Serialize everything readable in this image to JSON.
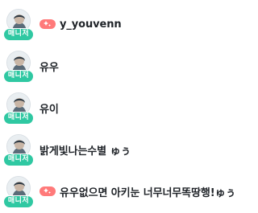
{
  "users": [
    {
      "name": "y_youvenn",
      "role_badge": "매니저",
      "has_pink_badge": true,
      "avatar_icon": "avatar-image"
    },
    {
      "name": "유우",
      "role_badge": "매니저",
      "has_pink_badge": false,
      "avatar_icon": "avatar-image"
    },
    {
      "name": "유이",
      "role_badge": "매니저",
      "has_pink_badge": false,
      "avatar_icon": "avatar-image"
    },
    {
      "name": "밝게빛나는수별 ゅぅ",
      "role_badge": "매니저",
      "has_pink_badge": false,
      "avatar_icon": "avatar-image"
    },
    {
      "name": "유우없으면 아키눈 너무너무똑땅행!ゅぅ",
      "role_badge": "매니저",
      "has_pink_badge": true,
      "avatar_icon": "avatar-image"
    }
  ],
  "colors": {
    "manager_badge": "#2fc8a2",
    "pink_badge": "#ff7a7a",
    "name_text": "#1f2328"
  }
}
